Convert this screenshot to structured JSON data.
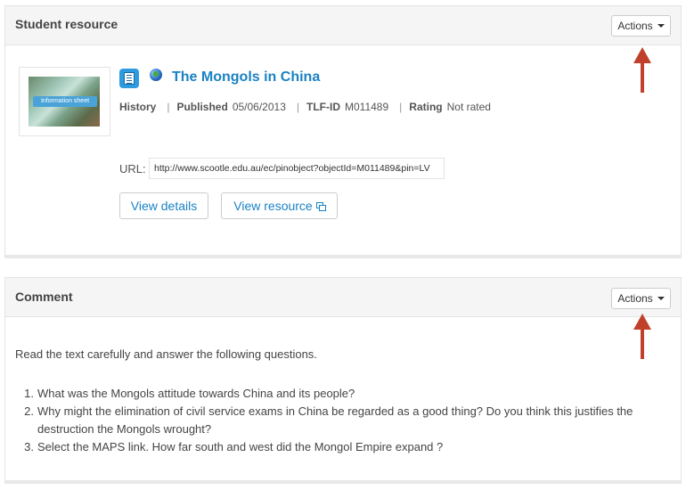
{
  "student_resource": {
    "title": "Student resource",
    "actions_label": "Actions",
    "thumbnail_label": "Information sheet",
    "resource_title": "The Mongols in China",
    "subject": "History",
    "published_label": "Published",
    "published_date": "05/06/2013",
    "tlf_label": "TLF-ID",
    "tlf_id": "M011489",
    "rating_label": "Rating",
    "rating_value": "Not rated",
    "url_label": "URL:",
    "url_value": "http://www.scootle.edu.au/ec/pinobject?objectId=M011489&pin=LV",
    "view_details_label": "View details",
    "view_resource_label": "View resource"
  },
  "comment": {
    "title": "Comment",
    "actions_label": "Actions",
    "intro": "Read the text carefully and answer the following questions.",
    "questions": [
      {
        "num": "1.",
        "text": "What was the Mongols attitude towards China and its people?"
      },
      {
        "num": "2.",
        "text": "Why might the elimination of civil service exams in China be regarded as a good thing? Do you think this justifies the destruction the Mongols wrought?"
      },
      {
        "num": "3.",
        "text": "Select the MAPS link. How far south and west did the Mongol Empire expand ?"
      }
    ]
  },
  "colors": {
    "link": "#1a82c4",
    "annotation_arrow": "#c0412b",
    "header_bg": "#f5f5f5"
  }
}
